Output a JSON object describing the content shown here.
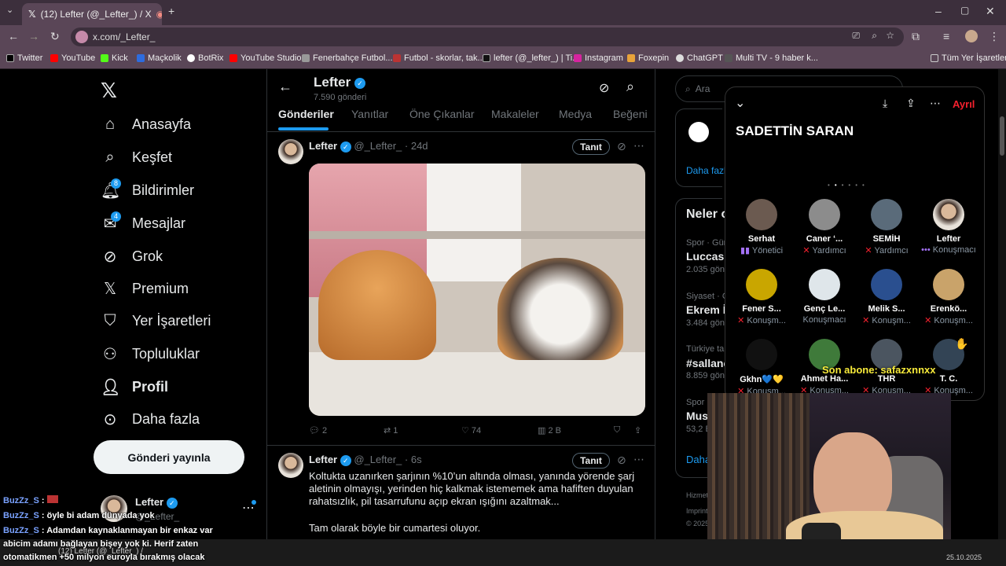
{
  "browser": {
    "tab_title": "(12) Lefter (@_Lefter_) / X",
    "url": "x.com/_Lefter_",
    "bookmarks": [
      "Twitter",
      "YouTube",
      "Kick",
      "Maçkolik",
      "BotRix",
      "YouTube Studio",
      "Fenerbahçe Futbol...",
      "Futbol - skorlar, tak...",
      "lefter (@_lefter_) | Ti...",
      "Instagram",
      "Foxepin",
      "ChatGPT",
      "Multi TV - 9 haber k..."
    ],
    "all_bookmarks": "Tüm Yer İşaretleri"
  },
  "sidebar": {
    "items": [
      "Anasayfa",
      "Keşfet",
      "Bildirimler",
      "Mesajlar",
      "Grok",
      "Premium",
      "Yer İşaretleri",
      "Topluluklar",
      "Profil",
      "Daha fazla"
    ],
    "notif_badge": "8",
    "msg_badge": "4",
    "post_button": "Gönderi yayınla",
    "account_name": "Lefter",
    "account_handle": "@_Lefter_"
  },
  "profile_header": {
    "name": "Lefter",
    "posts_count": "7.590 gönderi",
    "tabs": [
      "Gönderiler",
      "Yanıtlar",
      "Öne Çıkanlar",
      "Makaleler",
      "Medya",
      "Beğeni"
    ]
  },
  "posts": [
    {
      "name": "Lefter",
      "handle": "@_Lefter_",
      "time": "· 24d",
      "follow": "Tanıt",
      "replies": "2",
      "retweets": "1",
      "likes": "74",
      "views": "2 B"
    },
    {
      "name": "Lefter",
      "handle": "@_Lefter_",
      "time": "· 6s",
      "follow": "Tanıt",
      "text1": "Koltukta uzanırken şarjının %10’un altında olması, yanında yörende şarj aletinin olmayışı, yerinden hiç kalkmak istememek ama hafiften duyulan rahatsızlık, pil tasarrufunu açıp ekran ışığını azaltmak...",
      "text2": "Tam olarak böyle bir cumartesi oluyor."
    }
  ],
  "right": {
    "search_placeholder": "Ara",
    "show_more": "Daha fazla",
    "whats_happening": "Neler o",
    "trends": [
      {
        "cat": "Spor · Gün",
        "title": "Luccas C",
        "count": "2.035 gön"
      },
      {
        "cat": "Siyaset · G",
        "title": "Ekrem İn",
        "count": "3.484 gön"
      },
      {
        "cat": "Türkiye ta",
        "title": "#sallanc",
        "count": "8.859 gön"
      },
      {
        "cat": "Spor · Gün",
        "title": "Must",
        "count": "53,2 B"
      }
    ],
    "show_more2": "Daha",
    "footer1": "Hizmet",
    "footer2": "Imprint",
    "footer3": "© 2025"
  },
  "space": {
    "title": "SADETTİN SARAN",
    "leave": "Ayrıl",
    "speakers": [
      {
        "name": "Serhat",
        "role": "Yönetici"
      },
      {
        "name": "Caner ‘...",
        "role": "Yardımcı"
      },
      {
        "name": "SEMİH",
        "role": "Yardımcı"
      },
      {
        "name": "Lefter",
        "role": "Konuşmacı"
      },
      {
        "name": "Fener S...",
        "role": "Konuşm..."
      },
      {
        "name": "Genç Le...",
        "role": "Konuşmacı"
      },
      {
        "name": "Melik S...",
        "role": "Konuşm..."
      },
      {
        "name": "Erenkö...",
        "role": "Konuşm..."
      },
      {
        "name": "Gkhn💙💛",
        "role": "Konuşm..."
      },
      {
        "name": "Ahmet Ha...",
        "role": "Konuşm..."
      },
      {
        "name": "THR",
        "role": "Konuşm..."
      },
      {
        "name": "T. C.",
        "role": "Konuşm..."
      }
    ],
    "sub_overlay": "Son abone: safazxnnxx"
  },
  "chat": [
    {
      "user": "BuzZz_S",
      "msg": ""
    },
    {
      "user": "BuzZz_S",
      "msg": "öyle bi adam dünyada yok"
    },
    {
      "user": "BuzZz_S",
      "msg": "Adamdan kaynaklanmayan bir enkaz var"
    },
    {
      "user": "",
      "msg": "abicim adamı bağlayan bişey yok ki. Herif zaten"
    },
    {
      "user": "",
      "msg": "otomatikmen +50 milyon euroyla bırakmış olacak"
    }
  ],
  "taskbar": {
    "item": "(12) Lefter (@_Lefter_) /",
    "date": "25.10.2025"
  },
  "colors": {
    "accent": "#1d9bf0",
    "leave": "#f4212e",
    "chrome": "#5a4657"
  }
}
